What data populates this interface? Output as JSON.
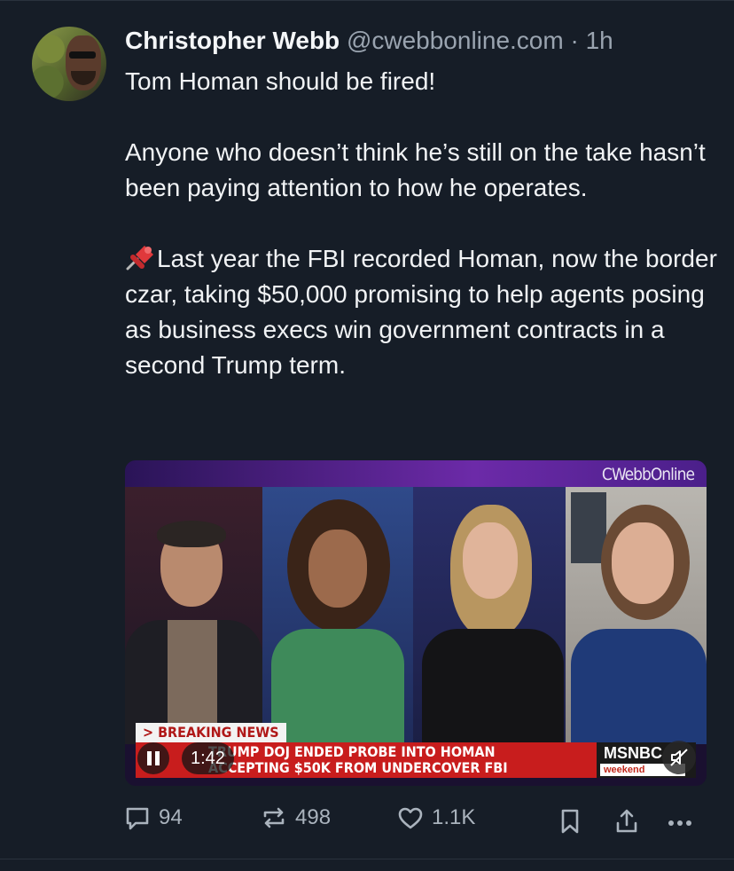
{
  "post": {
    "author_name": "Christopher Webb",
    "handle": "@cwebbonline.com",
    "separator": "·",
    "time": "1h",
    "text_line1": "Tom Homan should be fired!",
    "text_para2": "Anyone who doesn’t think he’s still on the take hasn’t been paying attention to how he operates.",
    "text_para3": "Last year the FBI recorded Homan, now the border czar, taking $50,000 promising to help agents posing as business execs win government contracts in a second Trump term.",
    "para3_icon": "pushpin-icon"
  },
  "video": {
    "watermark": "CWebbOnline",
    "breaking_label": "> BREAKING NEWS",
    "chyron_line1": "TRUMP DOJ ENDED PROBE INTO HOMAN",
    "chyron_line2": "ACCEPTING $50K FROM UNDERCOVER FBI",
    "network": "MSNBC",
    "show_tag": "weekend",
    "elapsed": "1:42",
    "state": "playing",
    "muted": true
  },
  "actions": {
    "reply_count": "94",
    "repost_count": "498",
    "like_count": "1.1K"
  },
  "colors": {
    "background": "#161d27",
    "muted_text": "#9aa4b0",
    "chyron_red": "#c81d1d"
  }
}
